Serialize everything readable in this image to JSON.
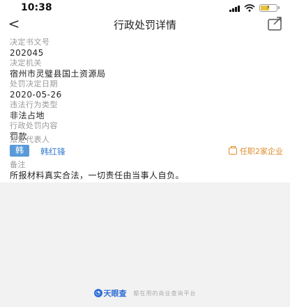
{
  "status": {
    "time": "10:38"
  },
  "nav": {
    "title": "行政处罚详情"
  },
  "fields": {
    "decision_no": {
      "label": "决定书文号",
      "value": "202045"
    },
    "authority": {
      "label": "决定机关",
      "value": "宿州市灵璧县国土资源局"
    },
    "decision_date": {
      "label": "处罚决定日期",
      "value": "2020-05-26"
    },
    "violation_type": {
      "label": "违法行为类型",
      "value": "非法占地"
    },
    "penalty_content": {
      "label": "行政处罚内容",
      "value": "罚款"
    },
    "legal_rep": {
      "label": "法定代表人"
    },
    "remark": {
      "label": "备注",
      "value": "所报材料真实合法，一切责任由当事人自负。"
    }
  },
  "legal_rep": {
    "badge": "韩",
    "name": "韩红锋",
    "link": "任职2家企业"
  },
  "footer": {
    "logo": "天眼查",
    "slogan": "都在用的商业查询平台"
  },
  "colors": {
    "link": "#3a7fd0",
    "accent": "#e08a2a",
    "badge": "#5b9ad8",
    "brand": "#2f6fd6"
  }
}
